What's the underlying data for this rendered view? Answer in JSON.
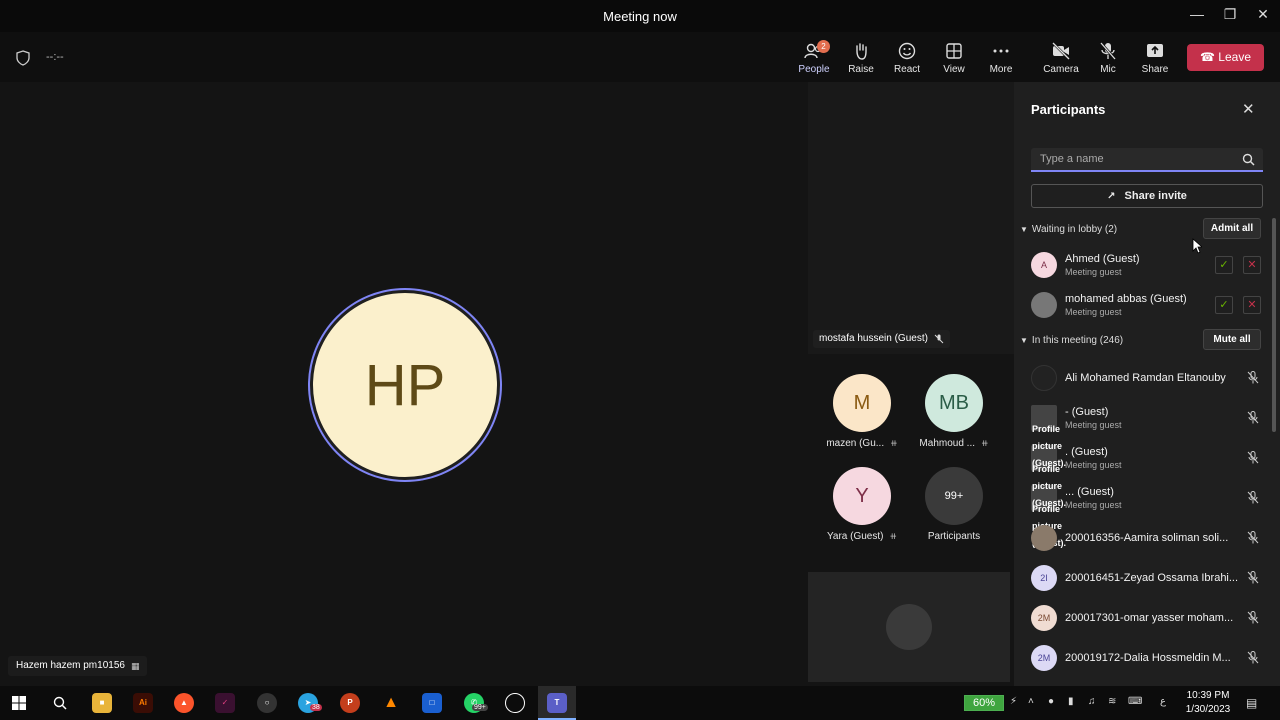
{
  "window": {
    "title": "Meeting now"
  },
  "toolbar": {
    "timer": "--:--",
    "people_label": "People",
    "people_badge": "2",
    "raise_label": "Raise",
    "react_label": "React",
    "view_label": "View",
    "more_label": "More",
    "camera_label": "Camera",
    "mic_label": "Mic",
    "share_label": "Share",
    "leave_label": "Leave"
  },
  "stage": {
    "main_initials": "HP",
    "me_name": "Hazem hazem pm10156"
  },
  "side": {
    "screen_label": "mostafa hussein (Guest)",
    "tiles": [
      {
        "initials": "M",
        "name": "mazen (Gu...",
        "color": "#fbe6c8",
        "text_color": "#8a5a12"
      },
      {
        "initials": "MB",
        "name": "Mahmoud ...",
        "color": "#cfe9dd",
        "text_color": "#2b5d47"
      },
      {
        "initials": "Y",
        "name": "Yara (Guest)",
        "color": "#f6d8e0",
        "text_color": "#7d2f48"
      },
      {
        "initials": "99+",
        "name": "Participants",
        "color": "#3a3a3a",
        "text_color": "#ffffff"
      }
    ]
  },
  "panel": {
    "title": "Participants",
    "search_placeholder": "Type a name",
    "share_invite": "Share invite",
    "lobby_header": "Waiting in lobby (2)",
    "admit_all": "Admit all",
    "meeting_header": "In this meeting (246)",
    "mute_all": "Mute all",
    "lobby": [
      {
        "initials": "A",
        "name": "Ahmed (Guest)",
        "sub": "Meeting guest",
        "color": "#f6d8e0",
        "text_color": "#7d2f48"
      },
      {
        "initials": "",
        "name": "mohamed abbas (Guest)",
        "sub": "Meeting guest",
        "color": "#777777",
        "text_color": "#ffffff"
      }
    ],
    "profile_text": "Profile picture (Guest).",
    "members": [
      {
        "initials": "",
        "name": "Ali Mohamed Ramdan Eltanouby",
        "sub": "",
        "color": "#222222",
        "text_color": "#ffffff"
      },
      {
        "initials": "",
        "name": "- (Guest)",
        "sub": "Meeting guest",
        "color": "#444444",
        "text_color": "#ffffff"
      },
      {
        "initials": "",
        "name": ". (Guest)",
        "sub": "Meeting guest",
        "color": "#444444",
        "text_color": "#ffffff"
      },
      {
        "initials": "",
        "name": "... (Guest)",
        "sub": "Meeting guest",
        "color": "#444444",
        "text_color": "#ffffff"
      },
      {
        "initials": "",
        "name": "200016356-Aamira soliman soli...",
        "sub": "",
        "color": "#8a7a6a",
        "text_color": "#ffffff"
      },
      {
        "initials": "2I",
        "name": "200016451-Zeyad Ossama Ibrahi...",
        "sub": "",
        "color": "#dcd9f5",
        "text_color": "#4b4596"
      },
      {
        "initials": "2M",
        "name": "200017301-omar yasser moham...",
        "sub": "",
        "color": "#f0dcd2",
        "text_color": "#7a4a33"
      },
      {
        "initials": "2M",
        "name": "200019172-Dalia Hossmeldin M...",
        "sub": "",
        "color": "#dcd9f5",
        "text_color": "#4b4596"
      }
    ]
  },
  "taskbar": {
    "battery": "60%",
    "time": "10:39 PM",
    "date": "1/30/2023",
    "whatsapp_badge": "99+",
    "telegram_badge": "38",
    "lang": "ع"
  }
}
